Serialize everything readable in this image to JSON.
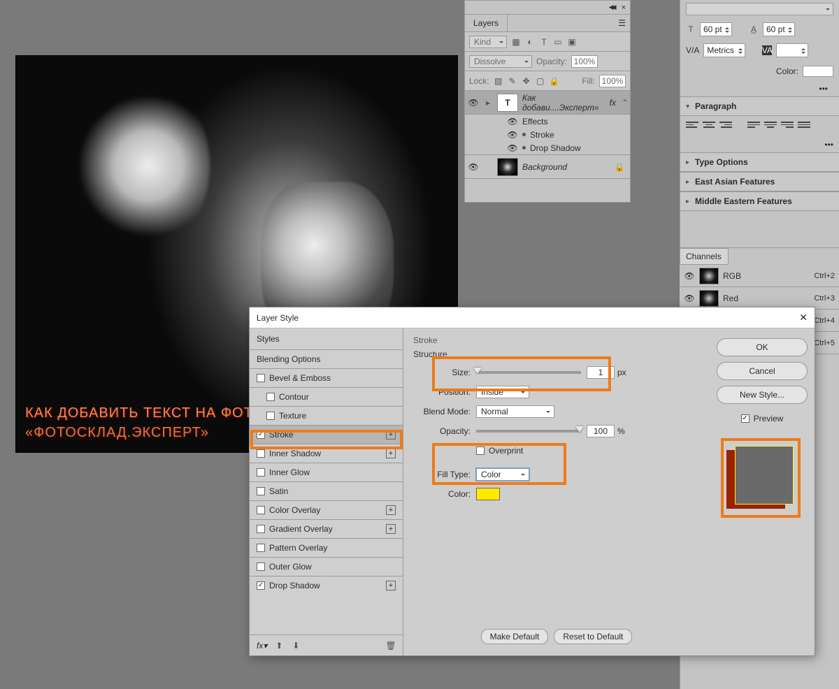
{
  "canvas": {
    "text1": "КАК ДОБАВИТЬ ТЕКСТ НА ФОТО",
    "text2": "«ФОТОСКЛАД.ЭКСПЕРТ»"
  },
  "layers_panel": {
    "title": "Layers",
    "kind_label": "Kind",
    "blend_mode": "Dissolve",
    "opacity_label": "Opacity:",
    "opacity_value": "100%",
    "lock_label": "Lock:",
    "fill_label": "Fill:",
    "fill_value": "100%",
    "text_layer": {
      "thumb_letter": "T",
      "name": "Как добави....Эксперт»",
      "fx_label": "fx",
      "effects_label": "Effects",
      "effects": [
        "Stroke",
        "Drop Shadow"
      ]
    },
    "background_layer": {
      "name": "Background"
    }
  },
  "right": {
    "char": {
      "font_size": "60 pt",
      "leading": "60 pt",
      "kerning_label": "V/A",
      "kerning_value": "Metrics",
      "color_label": "Color:"
    },
    "paragraph_title": "Paragraph",
    "sections": [
      "Type Options",
      "East Asian Features",
      "Middle Eastern Features"
    ],
    "channels_title": "Channels",
    "channels": [
      {
        "name": "RGB",
        "sc": "Ctrl+2"
      },
      {
        "name": "Red",
        "sc": "Ctrl+3"
      },
      {
        "name": "",
        "sc": "Ctrl+4"
      },
      {
        "name": "",
        "sc": "Ctrl+5"
      }
    ]
  },
  "dialog": {
    "title": "Layer Style",
    "left": {
      "styles": "Styles",
      "blending": "Blending Options",
      "items": {
        "bevel": "Bevel & Emboss",
        "contour": "Contour",
        "texture": "Texture",
        "stroke": "Stroke",
        "inner_shadow": "Inner Shadow",
        "inner_glow": "Inner Glow",
        "satin": "Satin",
        "color_overlay": "Color Overlay",
        "gradient_overlay": "Gradient Overlay",
        "pattern_overlay": "Pattern Overlay",
        "outer_glow": "Outer Glow",
        "drop_shadow": "Drop Shadow"
      },
      "fx_label": "fx"
    },
    "stroke": {
      "heading": "Stroke",
      "structure_label": "Structure",
      "size_label": "Size:",
      "size_value": "1",
      "size_unit": "px",
      "position_label": "Position:",
      "position_value": "Inside",
      "blend_label": "Blend Mode:",
      "blend_value": "Normal",
      "opacity_label": "Opacity:",
      "opacity_value": "100",
      "opacity_unit": "%",
      "overprint_label": "Overprint",
      "fill_type_label": "Fill Type:",
      "fill_type_value": "Color",
      "color_label": "Color:",
      "color_value": "#ffea00",
      "make_default": "Make Default",
      "reset_default": "Reset to Default"
    },
    "right": {
      "ok": "OK",
      "cancel": "Cancel",
      "new_style": "New Style...",
      "preview": "Preview"
    }
  }
}
